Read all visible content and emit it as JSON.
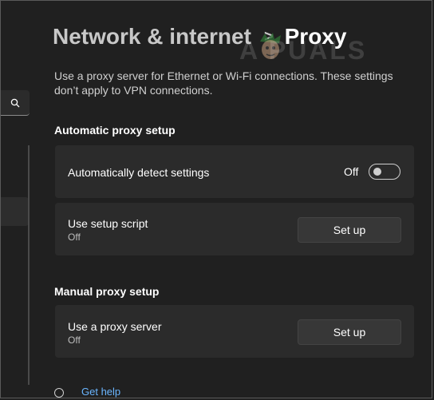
{
  "breadcrumb": {
    "parent": "Network & internet",
    "separator": ">",
    "current": "Proxy"
  },
  "watermark": {
    "text": "A  PUALS"
  },
  "description": "Use a proxy server for Ethernet or Wi-Fi connections. These settings don’t apply to VPN connections.",
  "automatic": {
    "heading": "Automatic proxy setup",
    "detect": {
      "label": "Automatically detect settings",
      "state_text": "Off"
    },
    "script": {
      "label": "Use setup script",
      "status": "Off",
      "button_label": "Set up"
    }
  },
  "manual": {
    "heading": "Manual proxy setup",
    "proxy": {
      "label": "Use a proxy server",
      "status": "Off",
      "button_label": "Set up"
    }
  },
  "help": {
    "label": "Get help"
  },
  "icons": {
    "search": "search-icon",
    "help": "help-icon"
  },
  "colors": {
    "background": "#202020",
    "card": "#2b2b2b",
    "button": "#373737",
    "link": "#6bb6ff"
  }
}
